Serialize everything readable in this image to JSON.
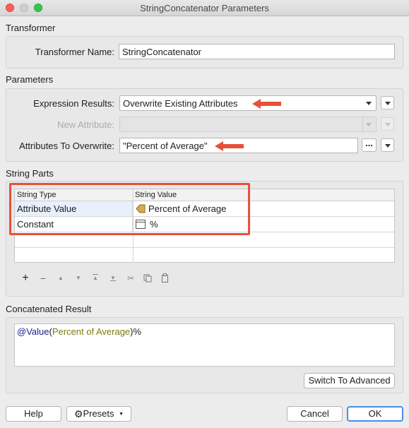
{
  "window": {
    "title": "StringConcatenator Parameters"
  },
  "transformer": {
    "section_label": "Transformer",
    "name_label": "Transformer Name:",
    "name_value": "StringConcatenator"
  },
  "parameters": {
    "section_label": "Parameters",
    "expression_results_label": "Expression Results:",
    "expression_results_value": "Overwrite Existing Attributes",
    "new_attribute_label": "New Attribute:",
    "new_attribute_value": "",
    "attributes_to_overwrite_label": "Attributes To Overwrite:",
    "attributes_to_overwrite_value": "\"Percent of Average\"",
    "dots_label": "..."
  },
  "string_parts": {
    "section_label": "String Parts",
    "columns": [
      "String Type",
      "String Value"
    ],
    "rows": [
      {
        "type": "Attribute Value",
        "value": "Percent of Average",
        "icon": "attribute-icon"
      },
      {
        "type": "Constant",
        "value": "%",
        "icon": "constant-icon"
      }
    ],
    "toolbar": [
      "add-icon",
      "remove-icon",
      "move-up-icon",
      "move-down-icon",
      "move-top-icon",
      "move-bottom-icon",
      "cut-icon",
      "copy-icon",
      "paste-icon"
    ]
  },
  "concatenated_result": {
    "section_label": "Concatenated Result",
    "function": "@Value",
    "open_paren": "(",
    "argument": "Percent of Average",
    "close_paren": ")",
    "suffix": "%",
    "switch_button": "Switch To Advanced"
  },
  "footer": {
    "help": "Help",
    "presets": "Presets",
    "cancel": "Cancel",
    "ok": "OK"
  },
  "colors": {
    "annotation": "#e8503a",
    "primary_border": "#4a8fe7"
  }
}
